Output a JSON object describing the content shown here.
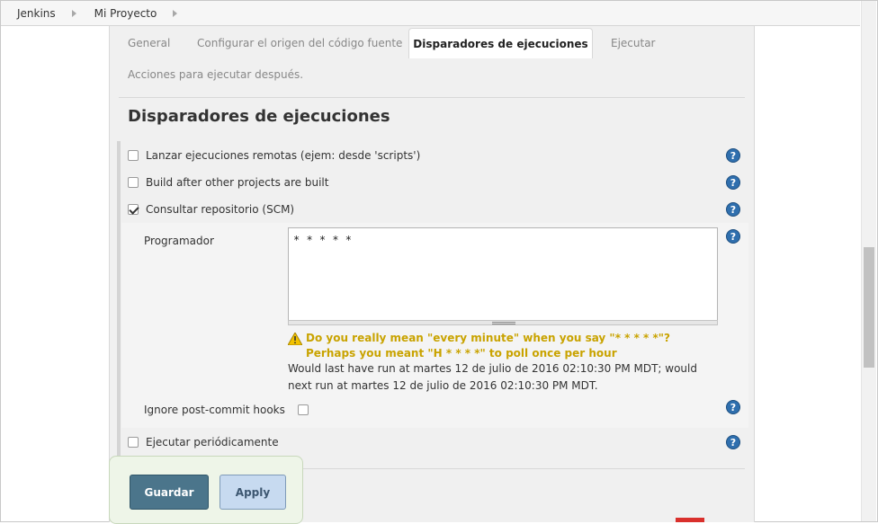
{
  "breadcrumb": {
    "items": [
      "Jenkins",
      "Mi Proyecto"
    ]
  },
  "tabs": {
    "items": [
      "General",
      "Configurar el origen del código fuente",
      "Disparadores de ejecuciones",
      "Ejecutar",
      "Acciones para ejecutar después."
    ],
    "active": "Disparadores de ejecuciones"
  },
  "section": {
    "title": "Disparadores de ejecuciones"
  },
  "triggers": [
    {
      "label": "Lanzar ejecuciones remotas (ejem: desde 'scripts')",
      "checked": false
    },
    {
      "label": "Build after other projects are built",
      "checked": false
    },
    {
      "label": "Consultar repositorio (SCM)",
      "checked": true
    },
    {
      "label": "Ejecutar periódicamente",
      "checked": false
    }
  ],
  "schedule": {
    "label": "Programador",
    "value": "* * * * *",
    "warning": "Do you really mean \"every minute\" when you say \"* * * * *\"? Perhaps you meant \"H * * * *\" to poll once per hour",
    "info": "Would last have run at martes 12 de julio de 2016 02:10:30 PM MDT; would next run at martes 12 de julio de 2016 02:10:30 PM MDT."
  },
  "ignore_hooks": {
    "label": "Ignore post-commit hooks",
    "checked": false
  },
  "help_icon_glyph": "?",
  "buttons": {
    "save": "Guardar",
    "apply": "Apply"
  },
  "colors": {
    "warning": "#c9a300",
    "save_button": "#4b758b",
    "apply_button": "#c7daf0",
    "help_icon": "#2f6fae"
  }
}
